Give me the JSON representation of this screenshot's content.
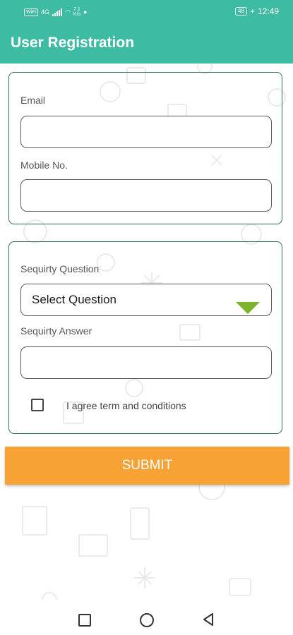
{
  "status_bar": {
    "wifi_badge": "WiFi",
    "network_type": "4G",
    "speed_value": "7.1",
    "speed_unit": "K/s",
    "battery": "48",
    "time": "12:49"
  },
  "app_bar": {
    "title": "User Registration"
  },
  "form": {
    "email_label": "Email",
    "email_value": "",
    "mobile_label": "Mobile No.",
    "mobile_value": "",
    "question_label": "Sequirty Question",
    "question_selected": "Select Question",
    "answer_label": "Sequirty Answer",
    "answer_value": "",
    "agree_label": "I agree term and conditions",
    "agree_checked": false
  },
  "submit_label": "SUBMIT",
  "colors": {
    "header": "#3dbba3",
    "card_border": "#2e6e56",
    "submit": "#f6a235",
    "dropdown_arrow": "#79b024"
  },
  "nav_icons": [
    "recent-apps-icon",
    "home-icon",
    "back-icon"
  ]
}
